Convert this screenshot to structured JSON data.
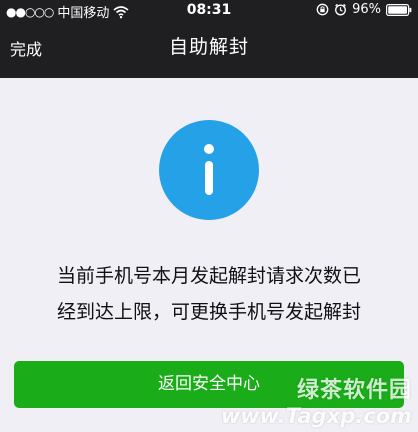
{
  "status_bar": {
    "signal": "●●○○○",
    "carrier": "中国移动",
    "time": "08:31",
    "battery_percent": "96%"
  },
  "nav": {
    "done_label": "完成",
    "title": "自助解封"
  },
  "message": {
    "line1": "当前手机号本月发起解封请求次数已",
    "line2": "经到达上限，可更换手机号发起解封"
  },
  "button": {
    "label": "返回安全中心"
  },
  "watermark": {
    "cn": "绿茶软件园",
    "en": "www.Tagxp.com"
  },
  "colors": {
    "topbar": "#1f1f22",
    "background": "#f0eff5",
    "info_blue": "#25a1e8",
    "button_green": "#1aad19"
  },
  "icons": {
    "status": [
      "wifi-icon",
      "lock-rotation-icon",
      "alarm-icon",
      "battery-icon"
    ],
    "main": "info-icon"
  }
}
